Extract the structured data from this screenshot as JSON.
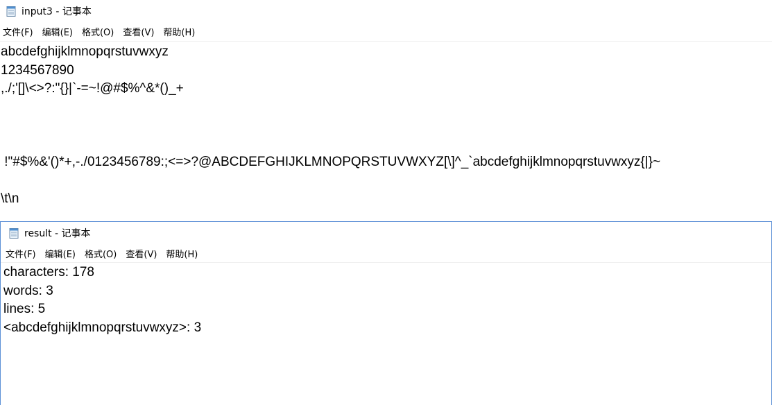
{
  "window1": {
    "title": "input3 - 记事本",
    "menu": [
      "文件(F)",
      "编辑(E)",
      "格式(O)",
      "查看(V)",
      "帮助(H)"
    ],
    "lines": [
      "abcdefghijklmnopqrstuvwxyz",
      "1234567890",
      ",./;'[]\\<>?:\"{}|`-=~!@#$%^&*()_+",
      "",
      "",
      "",
      " !\"#$%&'()*+,-./0123456789:;<=>?@ABCDEFGHIJKLMNOPQRSTUVWXYZ[\\]^_`abcdefghijklmnopqrstuvwxyz{|}~",
      "",
      "\\t\\n"
    ]
  },
  "window2": {
    "title": "result - 记事本",
    "menu": [
      "文件(F)",
      "编辑(E)",
      "格式(O)",
      "查看(V)",
      "帮助(H)"
    ],
    "lines": [
      "characters: 178",
      "words: 3",
      "lines: 5",
      "<abcdefghijklmnopqrstuvwxyz>: 3"
    ]
  },
  "icons": {
    "notepad": "notepad-icon"
  }
}
